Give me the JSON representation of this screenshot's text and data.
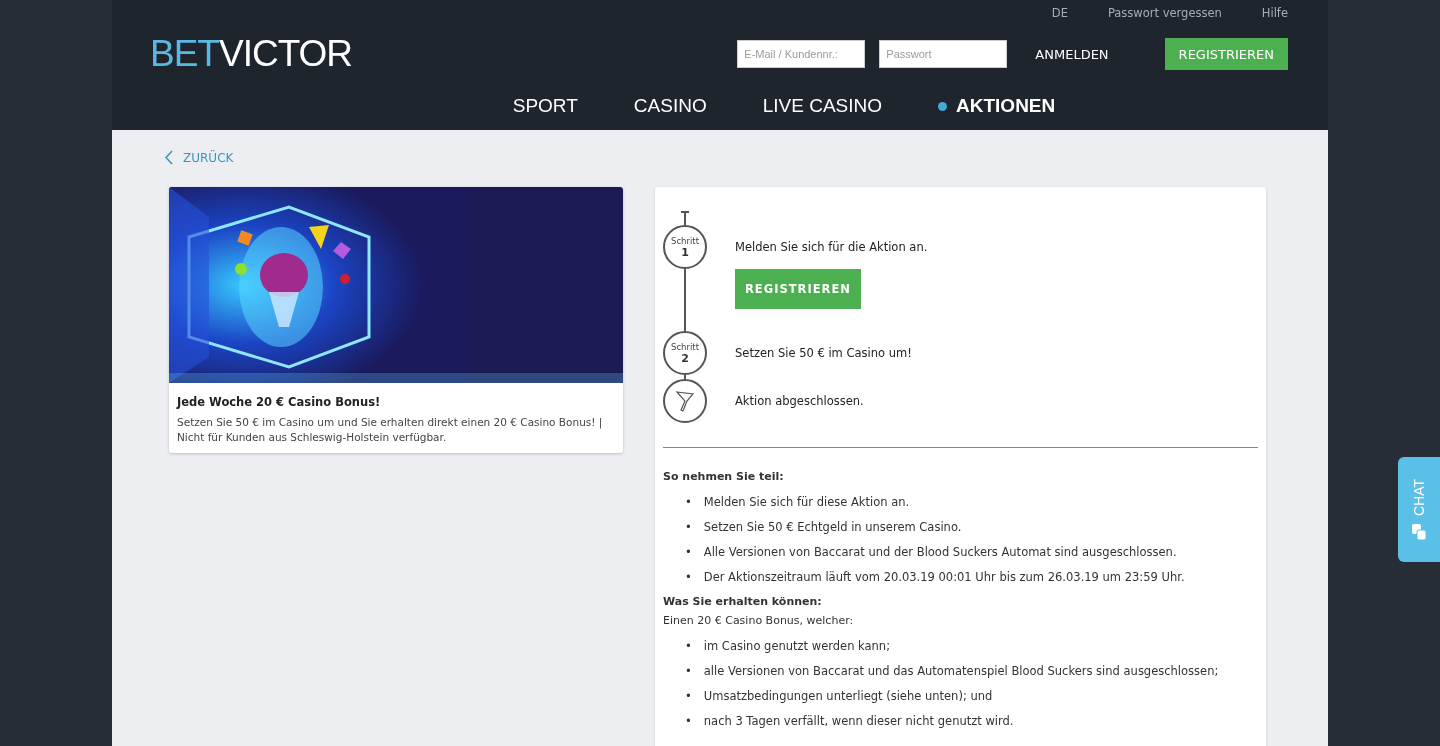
{
  "top_links": [
    "DE",
    "Passwort vergessen",
    "Hilfe"
  ],
  "logo": {
    "part_1": "BET",
    "part_2": "VICTOR"
  },
  "login": {
    "email_placeholder": "E-Mail / Kundennr.:",
    "password_placeholder": "Passwort",
    "login_button": "ANMELDEN",
    "register_button": "REGISTRIEREN"
  },
  "nav": [
    {
      "label": "SPORT",
      "selected": false
    },
    {
      "label": "CASINO",
      "selected": false
    },
    {
      "label": "LIVE CASINO",
      "selected": false
    },
    {
      "label": "AKTIONEN",
      "selected": true
    }
  ],
  "back_link": "ZURÜCK",
  "promo_card": {
    "title": "Jede Woche 20 € Casino Bonus!",
    "description": "Setzen Sie 50 € im Casino um und Sie erhalten direkt einen 20 € Casino Bonus! | Nicht für Kunden aus Schleswig-Holstein verfügbar."
  },
  "steps": [
    {
      "kind": "step",
      "label": "Schritt",
      "number": "1",
      "text": "Melden Sie sich für die Aktion an.",
      "button": "REGISTRIEREN"
    },
    {
      "kind": "step",
      "label": "Schritt",
      "number": "2",
      "text": "Setzen Sie 50 € im Casino um!"
    },
    {
      "kind": "finish",
      "text": "Aktion abgeschlossen."
    }
  ],
  "details": [
    {
      "kind": "heading",
      "text": "So nehmen Sie teil:"
    },
    {
      "kind": "list",
      "bullet": "•",
      "items": [
        "Melden Sie sich für diese Aktion an.",
        "Setzen Sie 50 € Echtgeld in unserem Casino.",
        "Alle Versionen von Baccarat und der Blood Suckers Automat sind ausgeschlossen.",
        "Der Aktionszeitraum läuft vom 20.03.19 00:01 Uhr bis zum 26.03.19 um 23:59 Uhr."
      ]
    },
    {
      "kind": "heading",
      "text": "Was Sie erhalten können:"
    },
    {
      "kind": "paragraph",
      "text": "Einen 20 € Casino Bonus, welcher:"
    },
    {
      "kind": "list",
      "bullet": "•",
      "items": [
        "im Casino genutzt werden kann;",
        "alle Versionen von Baccarat und das Automatenspiel Blood Suckers sind ausgeschlossen;",
        "Umsatzbedingungen unterliegt (siehe unten); und",
        "nach 3 Tagen verfällt, wenn dieser nicht genutzt wird."
      ]
    }
  ],
  "chat_tab": "CHAT"
}
